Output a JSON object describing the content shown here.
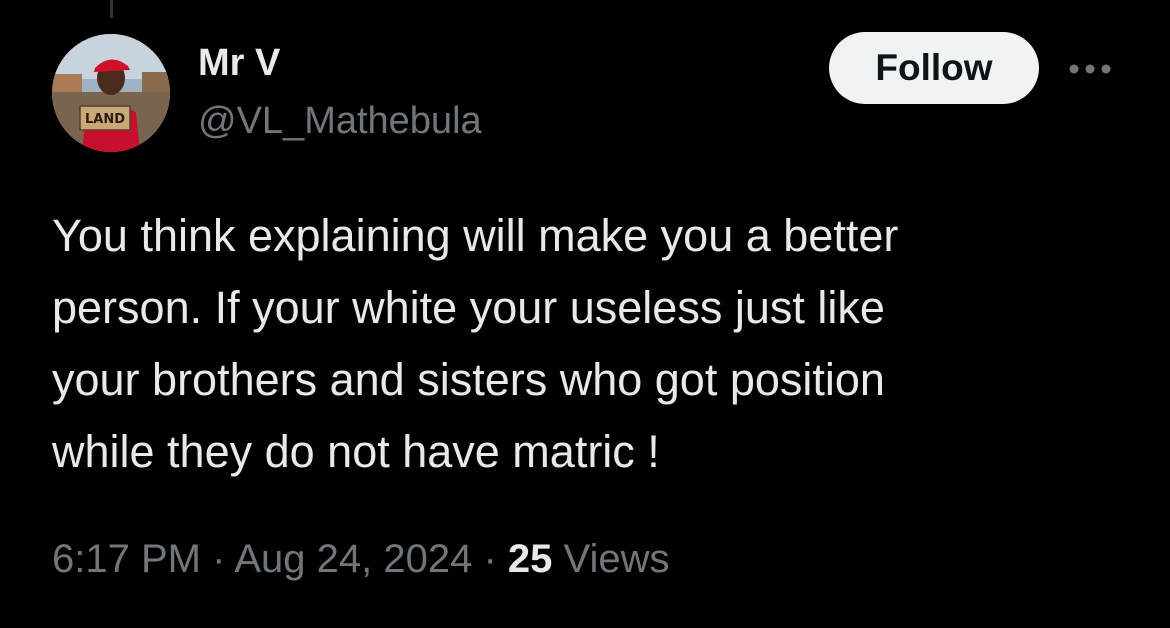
{
  "author": {
    "display_name": "Mr V",
    "handle": "@VL_Mathebula",
    "avatar_sign_text": "LAND"
  },
  "actions": {
    "follow_label": "Follow",
    "more_icon": "more-horizontal-icon"
  },
  "tweet": {
    "lines": [
      "You think explaining will make you a better",
      "person. If your white your useless just like",
      "your brothers and sisters who got position",
      "while they do not have matric !"
    ]
  },
  "meta": {
    "time": "6:17 PM",
    "separator": "·",
    "date": "Aug 24, 2024",
    "views_count": "25",
    "views_label": "Views"
  },
  "colors": {
    "background": "#000000",
    "primary_text": "#e7e9ea",
    "secondary_text": "#71767b",
    "follow_button_bg": "#eff3f4",
    "follow_button_text": "#0f1419"
  }
}
